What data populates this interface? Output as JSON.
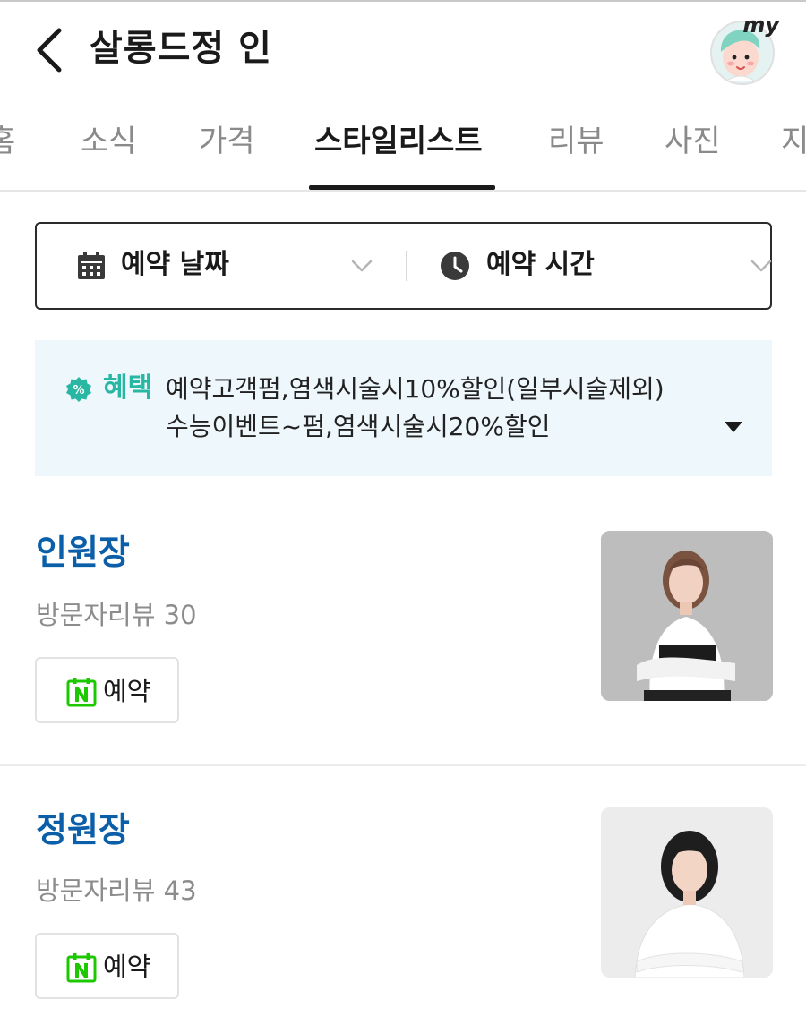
{
  "header": {
    "title": "살롱드정 인",
    "avatar_text": "my"
  },
  "tabs": [
    {
      "label": "홈",
      "active": false
    },
    {
      "label": "소식",
      "active": false
    },
    {
      "label": "가격",
      "active": false
    },
    {
      "label": "스타일리스트",
      "active": true
    },
    {
      "label": "리뷰",
      "active": false
    },
    {
      "label": "사진",
      "active": false
    },
    {
      "label": "지",
      "active": false
    }
  ],
  "picker": {
    "date_label": "예약 날짜",
    "time_label": "예약 시간"
  },
  "benefit": {
    "title": "혜택",
    "lines": [
      "예약고객펌,염색시술시10%할인(일부시술제외)",
      "수능이벤트~펌,염색시술시20%할인"
    ]
  },
  "stylists": [
    {
      "name": "인원장",
      "review": "방문자리뷰 30",
      "reserve_label": "예약"
    },
    {
      "name": "정원장",
      "review": "방문자리뷰 43",
      "reserve_label": "예약"
    }
  ],
  "colors": {
    "stylist_name": "#0b5ea8",
    "benefit_accent": "#27b7a3",
    "benefit_bg": "#eef7fc",
    "naver_green": "#1ec800"
  }
}
